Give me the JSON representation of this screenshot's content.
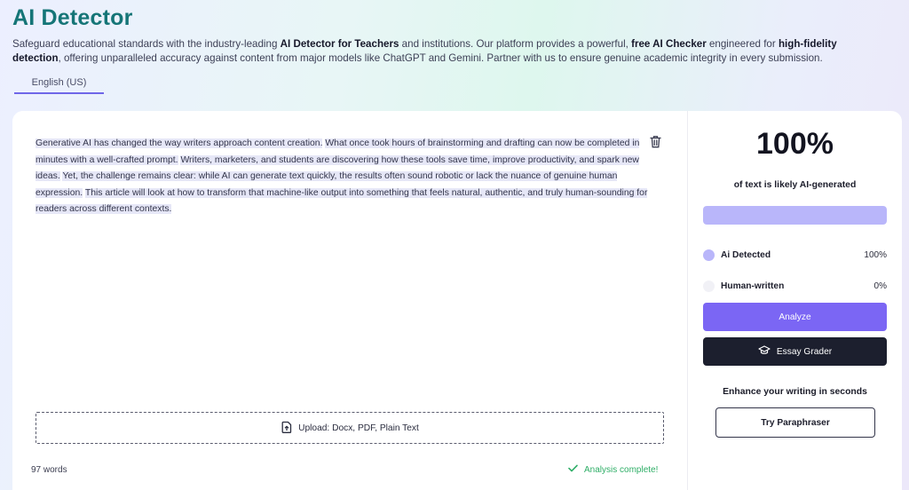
{
  "header": {
    "title": "AI Detector",
    "description_parts": [
      {
        "text": "Safeguard educational standards with the industry-leading ",
        "bold": false
      },
      {
        "text": "AI Detector for Teachers",
        "bold": true
      },
      {
        "text": " and institutions. Our platform provides a powerful, ",
        "bold": false
      },
      {
        "text": "free AI Checker",
        "bold": true
      },
      {
        "text": " engineered for ",
        "bold": false
      },
      {
        "text": "high-fidelity detection",
        "bold": true
      },
      {
        "text": ", offering unparalleled accuracy against content from major models like ChatGPT and Gemini. Partner with us to ensure genuine academic integrity in every submission.",
        "bold": false
      }
    ]
  },
  "language_tab": "English (US)",
  "editor": {
    "segments": [
      {
        "text": "Generative AI has changed the way writers approach content creation.",
        "highlight": true
      },
      {
        "text": "  ",
        "highlight": false
      },
      {
        "text": "What once took hours of brainstorming and drafting can now be completed in minutes with a well-crafted prompt.",
        "highlight": true
      },
      {
        "text": "  ",
        "highlight": false
      },
      {
        "text": "Writers, marketers, and students are discovering how these tools save time, improve productivity, and spark new ideas.",
        "highlight": true
      },
      {
        "text": " ",
        "highlight": false
      },
      {
        "text": "Yet, the challenge remains clear: while AI can generate text quickly, the results often sound robotic or lack the nuance of genuine human expression.",
        "highlight": true
      },
      {
        "text": " ",
        "highlight": false
      },
      {
        "text": "This article will look at how to transform that machine-like output into something that feels natural, authentic, and truly human-sounding for readers across different contexts.",
        "highlight": true
      }
    ],
    "upload_label": "Upload: Docx, PDF, Plain Text",
    "word_count": "97 words",
    "status": "Analysis complete!"
  },
  "result": {
    "score": "100%",
    "score_label": "of text is likely AI-generated",
    "ai_fraction": 1.0,
    "legend": {
      "ai_label": "Ai Detected",
      "ai_value": "100%",
      "human_label": "Human-written",
      "human_value": "0%"
    },
    "analyze_label": "Analyze",
    "grader_label": "Essay Grader",
    "enhance_label": "Enhance your writing in seconds",
    "paraphraser_label": "Try Paraphraser"
  },
  "colors": {
    "title": "#157577",
    "accent": "#7b66f4",
    "ai_dot": "#b9b6fa",
    "human_dot": "#f1f1f6",
    "success": "#2fae67"
  },
  "icons": {
    "trash": "trash-icon",
    "upload": "upload-file-icon",
    "check": "check-icon",
    "grader": "graduation-cap-icon"
  }
}
